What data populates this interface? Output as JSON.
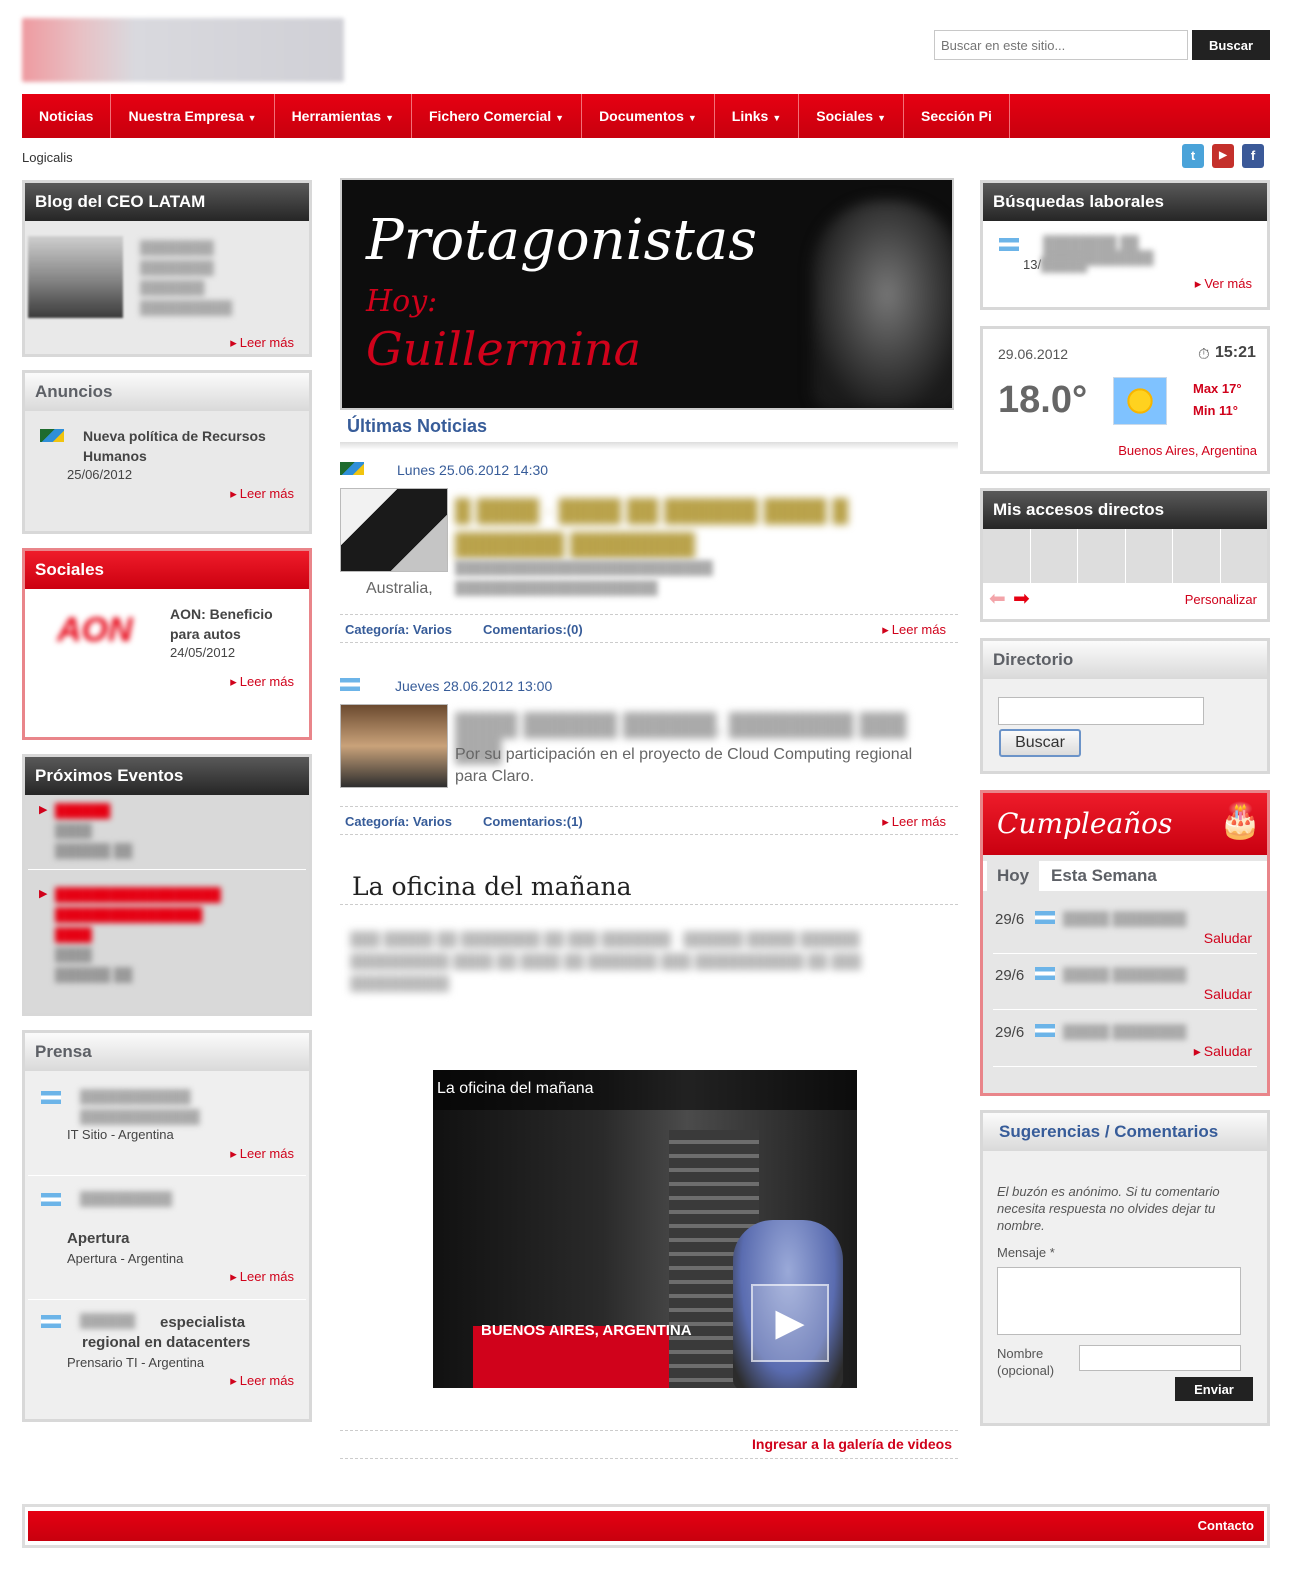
{
  "header": {
    "search_placeholder": "Buscar en este sitio...",
    "search_button": "Buscar"
  },
  "nav": [
    {
      "label": "Noticias",
      "caret": ""
    },
    {
      "label": "Nuestra Empresa",
      "caret": "▼"
    },
    {
      "label": "Herramientas",
      "caret": "▼"
    },
    {
      "label": "Fichero Comercial",
      "caret": "▼"
    },
    {
      "label": "Documentos",
      "caret": "▼"
    },
    {
      "label": "Links",
      "caret": "▼"
    },
    {
      "label": "Sociales",
      "caret": "▼"
    },
    {
      "label": "Sección Pi",
      "caret": ""
    }
  ],
  "breadcrumb": "Logicalis",
  "social_icons": [
    "twitter-icon",
    "youtube-icon",
    "facebook-icon"
  ],
  "left": {
    "blog": {
      "title": "Blog del CEO LATAM",
      "more": "Leer más"
    },
    "anuncios": {
      "title": "Anuncios",
      "item_title": "Nueva política de Recursos Humanos",
      "item_date": "25/06/2012",
      "more": "Leer más"
    },
    "sociales": {
      "title": "Sociales",
      "item_title": "AON: Beneficio para autos",
      "item_date": "24/05/2012",
      "more": "Leer más"
    },
    "eventos": {
      "title": "Próximos Eventos"
    },
    "prensa": {
      "title": "Prensa",
      "items": [
        {
          "title": "",
          "source": "IT Sitio - Argentina",
          "more": "Leer más"
        },
        {
          "title": "Apertura",
          "source": "Apertura - Argentina",
          "more": "Leer más"
        },
        {
          "title": "especialista regional en datacenters",
          "source": "Prensario TI - Argentina",
          "more": "Leer más"
        }
      ]
    }
  },
  "center": {
    "banner": {
      "line1": "Protagonistas",
      "line2": "Hoy:",
      "line3": "Guillermina"
    },
    "news_heading": "Últimas Noticias",
    "news": [
      {
        "date": "Lunes 25.06.2012 14:30",
        "snippet": "Australia,",
        "category": "Categoría: Varios",
        "comments": "Comentarios:(0)",
        "more": "Leer más"
      },
      {
        "date": "Jueves 28.06.2012 13:00",
        "snippet": "Por su participación en el proyecto de Cloud Computing regional para Claro.",
        "category": "Categoría: Varios",
        "comments": "Comentarios:(1)",
        "more": "Leer más"
      }
    ],
    "video_section_title": "La oficina del mañana",
    "video": {
      "title": "La oficina del mañana",
      "location": "BUENOS AIRES, ARGENTINA"
    },
    "gallery_link": "Ingresar a la galería de videos"
  },
  "right": {
    "busquedas": {
      "title": "Búsquedas laborales",
      "item_date": "13/",
      "more": "Ver más"
    },
    "weather": {
      "date": "29.06.2012",
      "time": "15:21",
      "temp": "18.0°",
      "max": "Max 17°",
      "min": "Min 11°",
      "location": "Buenos Aires, Argentina"
    },
    "accesos": {
      "title": "Mis accesos directos",
      "customize": "Personalizar"
    },
    "directorio": {
      "title": "Directorio",
      "button": "Buscar"
    },
    "cumple": {
      "title": "Cumpleaños",
      "tab_today": "Hoy",
      "tab_week": "Esta Semana",
      "items": [
        {
          "date": "29/6",
          "action": "Saludar"
        },
        {
          "date": "29/6",
          "action": "Saludar"
        },
        {
          "date": "29/6",
          "action": "Saludar"
        }
      ]
    },
    "sugerencias": {
      "title": "Sugerencias / Comentarios",
      "note": "El buzón es anónimo. Si tu comentario necesita respuesta no olvides dejar tu nombre.",
      "message_label": "Mensaje *",
      "name_label": "Nombre (opcional)",
      "submit": "Enviar"
    }
  },
  "footer": {
    "contact": "Contacto"
  },
  "colors": {
    "brand_red": "#e60012",
    "link_blue": "#375c99",
    "dark_header": "#262626"
  }
}
